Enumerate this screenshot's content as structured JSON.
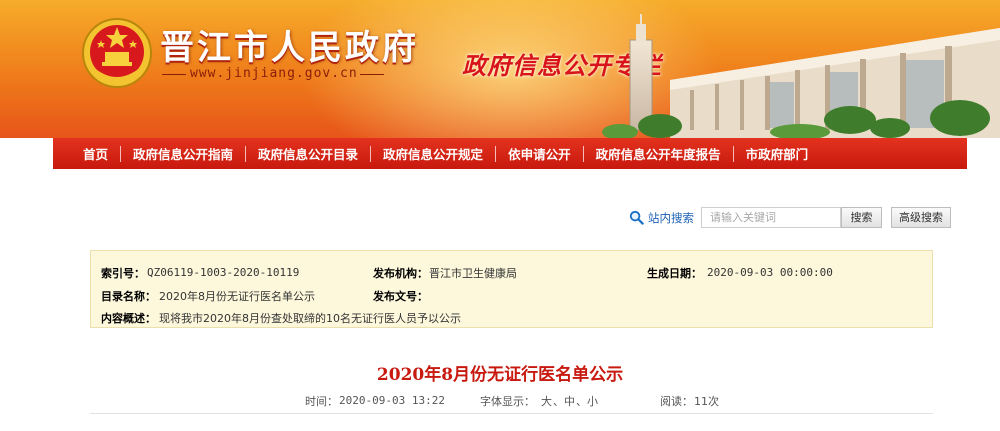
{
  "header": {
    "site_title": "晋江市人民政府",
    "site_url": "www.jinjiang.gov.cn",
    "column_title": "政府信息公开专栏",
    "colors": {
      "banner_top": "#f6ac2a",
      "banner_bottom": "#e7551a",
      "nav": "#c8190f",
      "title_red": "#c8190f"
    },
    "emblem_icon": "national-emblem-icon",
    "skyline_image": "city-hall-building"
  },
  "nav": {
    "items": [
      {
        "label": "首页"
      },
      {
        "label": "政府信息公开指南"
      },
      {
        "label": "政府信息公开目录"
      },
      {
        "label": "政府信息公开规定"
      },
      {
        "label": "依申请公开"
      },
      {
        "label": "政府信息公开年度报告"
      },
      {
        "label": "市政府部门"
      }
    ]
  },
  "search": {
    "label": "站内搜索",
    "placeholder": "请输入关键词",
    "button": "搜索",
    "advanced_button": "高级搜索",
    "icon": "search-icon"
  },
  "meta": {
    "index_label": "索引号：",
    "index_value": "QZ06119-1003-2020-10119",
    "publisher_label": "发布机构：",
    "publisher_value": "晋江市卫生健康局",
    "date_label": "生成日期：",
    "date_value": "2020-09-03 00:00:00",
    "catalog_label": "目录名称：",
    "catalog_value": "2020年8月份无证行医名单公示",
    "doc_no_label": "发布文号：",
    "doc_no_value": "",
    "summary_label": "内容概述：",
    "summary_value": "现将我市2020年8月份查处取缔的10名无证行医人员予以公示"
  },
  "article": {
    "title": "2020年8月份无证行医名单公示",
    "time_label": "时间：",
    "time_value": "2020-09-03 13:22",
    "font_label": "字体显示：",
    "font_large": "大",
    "font_medium": "中",
    "font_small": "小",
    "views_label": "阅读：",
    "views_value": "11次"
  }
}
